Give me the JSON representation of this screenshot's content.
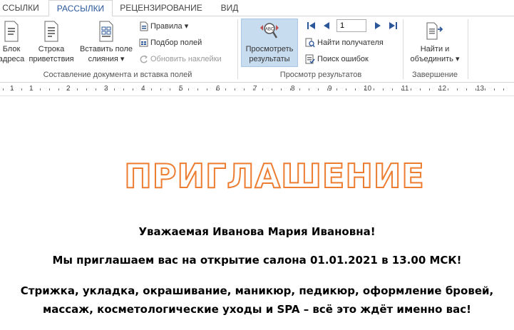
{
  "tabs": [
    {
      "label": "ССЫЛКИ",
      "active": false
    },
    {
      "label": "РАССЫЛКИ",
      "active": true
    },
    {
      "label": "РЕЦЕНЗИРОВАНИЕ",
      "active": false
    },
    {
      "label": "ВИД",
      "active": false
    }
  ],
  "ribbon": {
    "group1": {
      "label": "Составление документа и вставка полей",
      "address_block": {
        "line1": "Блок",
        "line2": "адреса"
      },
      "greeting_line": {
        "line1": "Строка",
        "line2": "приветствия"
      },
      "insert_field": {
        "line1": "Вставить поле",
        "line2": "слияния ▾"
      },
      "rules": "Правила ▾",
      "match_fields": "Подбор полей",
      "update_labels": "Обновить наклейки"
    },
    "group2": {
      "label": "Просмотр результатов",
      "preview": {
        "line1": "Просмотреть",
        "line2": "результаты"
      },
      "record_value": "1",
      "find_recipient": "Найти получателя",
      "check_errors": "Поиск ошибок"
    },
    "group3": {
      "label": "Завершение",
      "finish": {
        "line1": "Найти и",
        "line2": "объединить ▾"
      }
    }
  },
  "ruler": {
    "numbers": [
      "1",
      "1",
      "2",
      "3",
      "4",
      "5",
      "6",
      "7",
      "8",
      "9",
      "10",
      "11",
      "12",
      "13"
    ]
  },
  "document": {
    "title": "ПРИГЛАШЕНИЕ",
    "greeting": "Уважаемая Иванова Мария Ивановна!",
    "invite": "Мы приглашаем вас на открытие салона 01.01.2021 в 13.00 МСК!",
    "services_line1": "Стрижка, укладка, окрашивание, маникюр, педикюр, оформление бровей,",
    "services_line2": "массаж, косметологические уходы и SPA – всё это ждёт именно вас!"
  },
  "colors": {
    "title_outline": "#ed7d31",
    "accent": "#2b579a",
    "preview_highlight": "#c8dcf0"
  }
}
